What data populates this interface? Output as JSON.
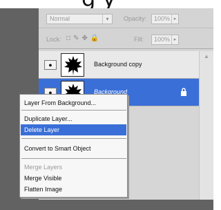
{
  "page": {
    "caption": "g   y"
  },
  "options": {
    "blend_mode": "Normal",
    "opacity_label": "Opacity:",
    "opacity_value": "100%",
    "lock_label": "Lock:",
    "fill_label": "Fill:",
    "fill_value": "100%"
  },
  "layers": [
    {
      "name": "Background copy"
    },
    {
      "name": "Background"
    }
  ],
  "context_menu": {
    "items": [
      {
        "label": "Layer From Background..."
      },
      {
        "label": "Duplicate Layer..."
      },
      {
        "label": "Delete Layer"
      },
      {
        "label": "Convert to Smart Object"
      },
      {
        "label": "Merge Layers"
      },
      {
        "label": "Merge Visible"
      },
      {
        "label": "Flatten Image"
      }
    ]
  },
  "colors": {
    "selection": "#3a6fd8",
    "panel": "#d6d6d6",
    "canvas_gray": "#626262"
  },
  "icons": {
    "eye": "eye-icon",
    "thumb": "maple-leaf-icon",
    "lock": "lock-icon"
  }
}
